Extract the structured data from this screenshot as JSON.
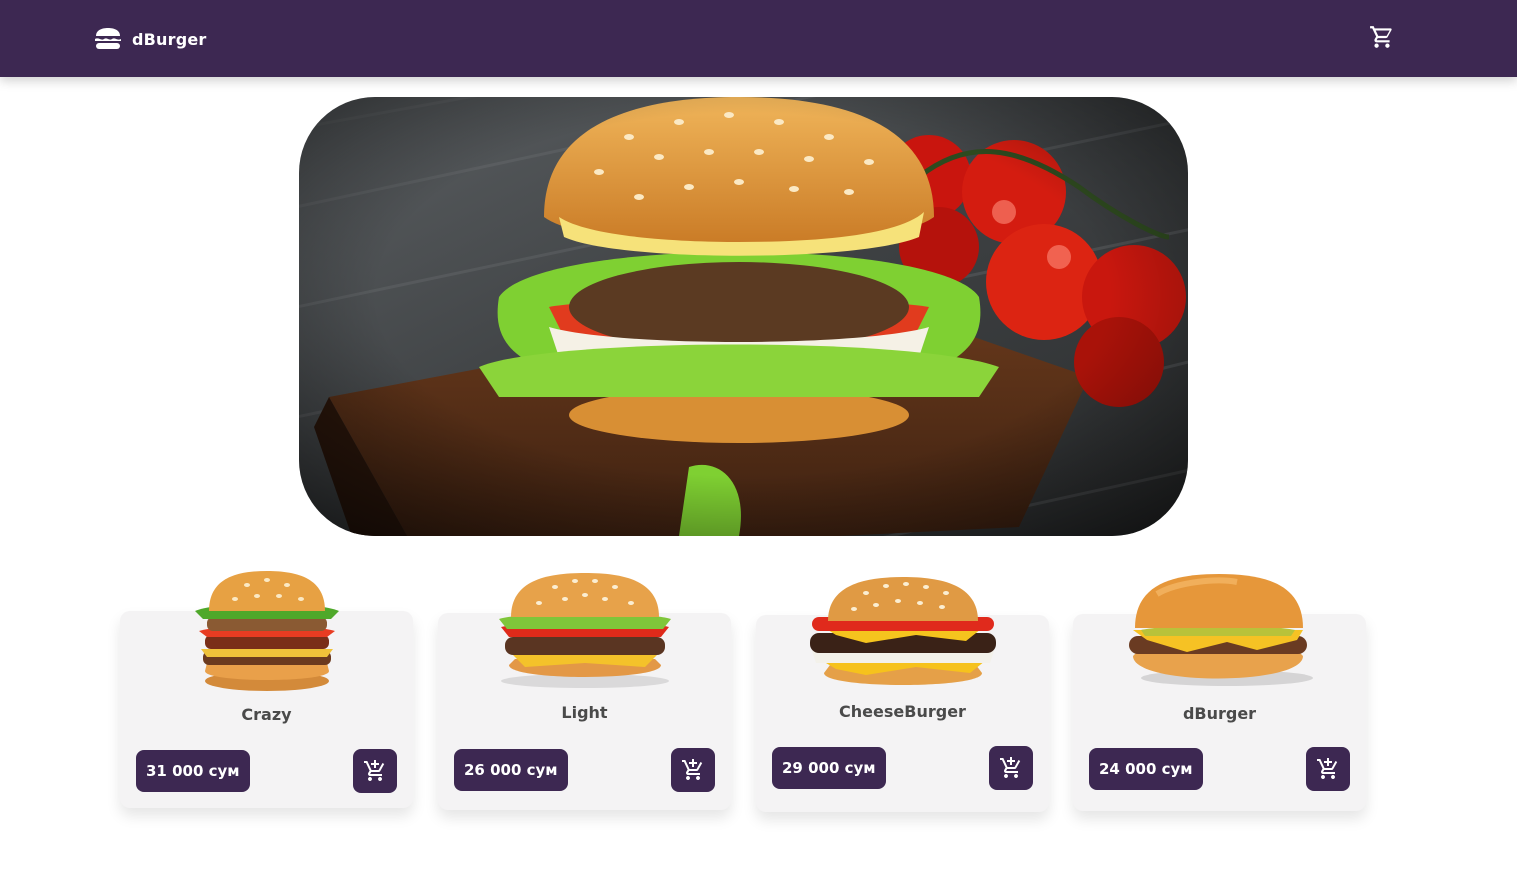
{
  "theme": {
    "brand": "#3d2852",
    "card_bg": "#f4f3f4",
    "name_color": "#4a4a4a"
  },
  "navbar": {
    "brand_name": "dBurger",
    "brand_icon": "burger-icon",
    "cart_icon": "cart-icon"
  },
  "hero": {
    "image": "burger-on-board-photo"
  },
  "products": [
    {
      "name": "Crazy",
      "price": "31 000 сум",
      "image": "stacked-burger",
      "icon": "add-to-cart-icon"
    },
    {
      "name": "Light",
      "price": "26 000 сум",
      "image": "classic-burger",
      "icon": "add-to-cart-icon"
    },
    {
      "name": "CheeseBurger",
      "price": "29 000 сум",
      "image": "cheese-burger",
      "icon": "add-to-cart-icon"
    },
    {
      "name": "dBurger",
      "price": "24 000 сум",
      "image": "simple-burger",
      "icon": "add-to-cart-icon"
    }
  ]
}
